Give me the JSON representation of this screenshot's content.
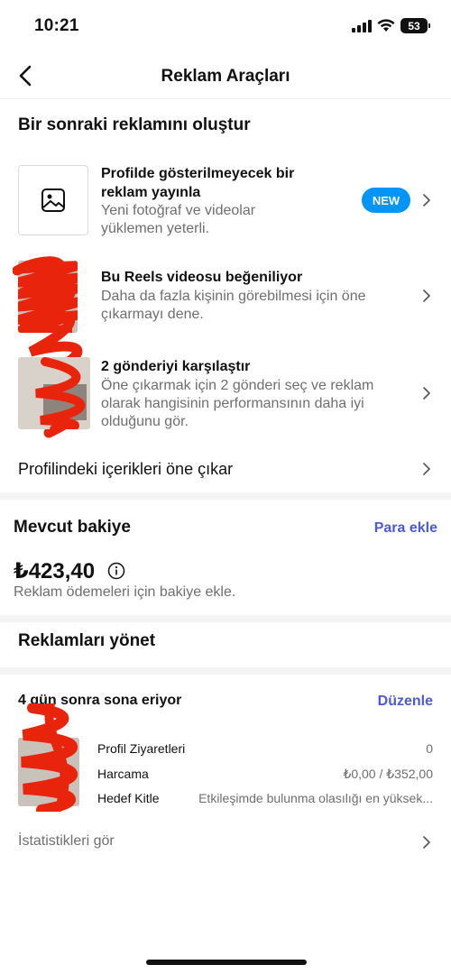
{
  "status_bar": {
    "time": "10:21",
    "battery": "53"
  },
  "nav": {
    "title": "Reklam Araçları"
  },
  "create_section": {
    "title": "Bir sonraki reklamını oluştur",
    "items": [
      {
        "title": "Profilde gösterilmeyecek bir reklam yayınla",
        "description": "Yeni fotoğraf ve videolar yüklemen yeterli.",
        "badge": "NEW"
      },
      {
        "title": "Bu Reels videosu beğeniliyor",
        "description": "Daha da fazla kişinin görebilmesi için öne çıkarmayı dene."
      },
      {
        "title": "2 gönderiyi karşılaştır",
        "description": "Öne çıkarmak için 2 gönderi seç ve reklam olarak hangisinin performansının daha iyi olduğunu gör."
      }
    ],
    "promote_label": "Profilindeki içerikleri öne çıkar"
  },
  "balance": {
    "title": "Mevcut bakiye",
    "add_funds": "Para ekle",
    "amount": "₺423,40",
    "note": "Reklam ödemeleri için bakiye ekle."
  },
  "manage": {
    "title": "Reklamları yönet"
  },
  "ad_card": {
    "status": "4 gün sonra sona eriyor",
    "edit": "Düzenle",
    "rows": [
      {
        "label": "Profil Ziyaretleri",
        "value": "0"
      },
      {
        "label": "Harcama",
        "value": "₺0,00 / ₺352,00"
      },
      {
        "label": "Hedef Kitle",
        "value": "Etkileşimde bulunma olasılığı en yüksek..."
      }
    ],
    "stats_link": "İstatistikleri gör"
  },
  "colors": {
    "accent_blue": "#0095f6",
    "link_blue": "#4a5bd4",
    "redaction": "#e8250c"
  },
  "icons": [
    "back-arrow-icon",
    "image-icon",
    "chevron-right-icon",
    "info-icon",
    "signal-icon",
    "wifi-icon",
    "battery-icon"
  ]
}
